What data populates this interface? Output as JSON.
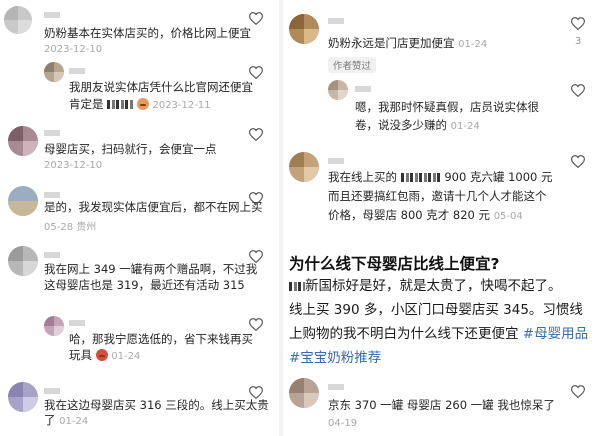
{
  "left": {
    "comments": [
      {
        "text_lines": [
          "奶粉基本在实体店买的，价格比网上便宜"
        ],
        "date": "2023-12-10",
        "likes": ""
      },
      {
        "reply": true,
        "text_lines": [
          "我朋友说实体店凭什么比官网还便宜",
          "肯定是"
        ],
        "date": "2023-12-11",
        "likes": ""
      },
      {
        "text_lines": [
          "母婴店买，扫码就行，会便宜一点"
        ],
        "date": "2023-12-10",
        "likes": ""
      },
      {
        "text_lines": [
          "是的，我发现实体店便宜后，都不在网上买"
        ],
        "date": "05-28 贵州",
        "likes": ""
      },
      {
        "text_lines": [
          "我在网上 349 一罐有两个赠品啊，不过我",
          "这母婴店也是 319，最近还有活动 315"
        ],
        "date": "",
        "likes": ""
      },
      {
        "reply": true,
        "text_lines": [
          "哈，那我宁愿选低的，省下来钱再买",
          "玩具"
        ],
        "date": "01-24",
        "likes": ""
      },
      {
        "text_lines": [
          "我在这边母婴店买 316 三段的。线上买太贵",
          "了"
        ],
        "date": "01-24",
        "likes": ""
      }
    ]
  },
  "right": {
    "comments": [
      {
        "text_lines": [
          "奶粉永远是门店更加便宜"
        ],
        "date": "01-24",
        "likes": "3",
        "badge": "作者赞过"
      },
      {
        "reply": true,
        "text_lines": [
          "嗯，我那时怀疑真假，店员说实体很",
          "卷，说没多少赚的"
        ],
        "date": "01-24",
        "likes": ""
      },
      {
        "text_lines": [
          "我在线上买的",
          "900 克六罐 1000 元",
          "而且还要搞红包雨，邀请十几个人才能这个",
          "价格，母婴店 800 克才 820 元"
        ],
        "date": "05-04",
        "likes": ""
      }
    ],
    "post": {
      "title": "为什么线下母婴店比线上便宜?",
      "lines": [
        "新国标好是好，就是太贵了，快喝不起了。",
        "线上买 390 多，小区门口母婴店买 345。习惯线",
        "上购物的我不明白为什么线下还更便宜"
      ],
      "tag1": "#母婴用品",
      "tag2": "#宝宝奶粉推荐"
    },
    "last_comment": {
      "text": "京东 370 一罐 母婴店 260 一罐 我也惊呆了",
      "date": "04-19"
    }
  },
  "colors": {
    "hashtag": "#3a6cb1",
    "meta": "#a9a9a9",
    "heart": "#555555"
  }
}
